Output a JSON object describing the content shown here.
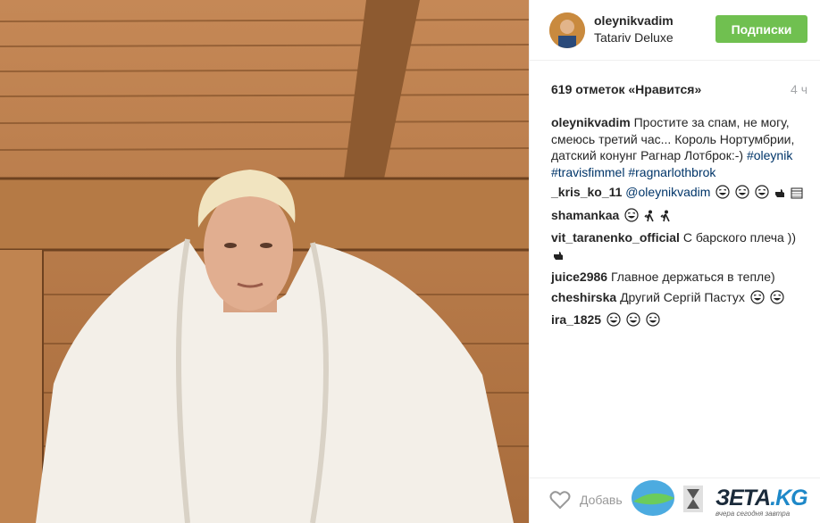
{
  "post": {
    "username": "oleynikvadim",
    "location": "Tatariv Deluxe",
    "follow_label": "Подписки",
    "likes_text": "619 отметок «Нравится»",
    "time_ago": "4 ч",
    "add_comment_placeholder": "Добавь",
    "colors": {
      "follow": "#70c050",
      "hashtag": "#003569"
    }
  },
  "caption": {
    "username": "oleynikvadim",
    "text": "Простите за спам, не могу, смеюсь третий час... Король Нортумбрии, датский конунг Рагнар Лотброк:-)",
    "tags": [
      "#oleynik",
      "#travisfimmel",
      "#ragnarlothbrok"
    ]
  },
  "comments": [
    {
      "user": "_kris_ko_11",
      "mention": "@oleynikvadim",
      "text": "",
      "emoji": [
        "laugh-emoji",
        "laugh-emoji",
        "laugh-emoji",
        "point-emoji",
        "calendar-emoji"
      ]
    },
    {
      "user": "shamankaa",
      "text": "",
      "emoji": [
        "laugh-emoji",
        "runner-emoji",
        "runner-emoji"
      ]
    },
    {
      "user": "vit_taranenko_official",
      "text": "С барского плеча ))",
      "emoji": [
        "point-emoji"
      ]
    },
    {
      "user": "juice2986",
      "text": "Главное держаться в тепле)",
      "emoji": []
    },
    {
      "user": "cheshirska",
      "text": "Другий Сергій Пастух",
      "emoji": [
        "laugh-emoji",
        "laugh-emoji"
      ]
    },
    {
      "user": "ira_1825",
      "text": "",
      "emoji": [
        "laugh-emoji",
        "laugh-emoji",
        "laugh-emoji"
      ]
    }
  ],
  "watermark": {
    "brand": "ЗЕТА",
    "domain": ".KG",
    "slogan": "вчера сегодня завтра"
  }
}
